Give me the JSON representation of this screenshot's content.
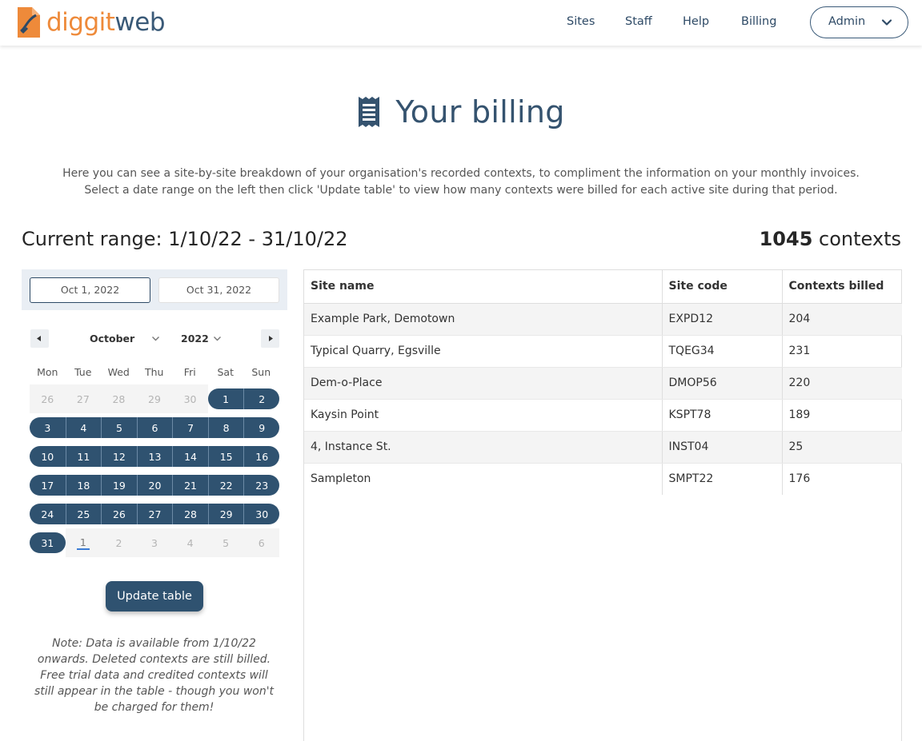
{
  "header": {
    "logo_part1": "diggit",
    "logo_part2": "web",
    "nav": [
      "Sites",
      "Staff",
      "Help",
      "Billing"
    ],
    "admin_label": "Admin"
  },
  "page": {
    "title": "Your billing",
    "intro_line1": "Here you can see a site-by-site breakdown of your organisation's recorded contexts, to compliment the information on your monthly invoices.",
    "intro_line2": "Select a date range on the left then click 'Update table' to view how many contexts were billed for each active site during that period.",
    "range_label": "Current range: 1/10/22 - 31/10/22",
    "count_value": "1045",
    "count_unit": "contexts"
  },
  "calendar": {
    "start_date": "Oct 1, 2022",
    "end_date": "Oct 31, 2022",
    "month": "October",
    "year": "2022",
    "weekdays": [
      "Mon",
      "Tue",
      "Wed",
      "Thu",
      "Fri",
      "Sat",
      "Sun"
    ],
    "weeks": [
      [
        "26",
        "27",
        "28",
        "29",
        "30",
        "1",
        "2"
      ],
      [
        "3",
        "4",
        "5",
        "6",
        "7",
        "8",
        "9"
      ],
      [
        "10",
        "11",
        "12",
        "13",
        "14",
        "15",
        "16"
      ],
      [
        "17",
        "18",
        "19",
        "20",
        "21",
        "22",
        "23"
      ],
      [
        "24",
        "25",
        "26",
        "27",
        "28",
        "29",
        "30"
      ],
      [
        "31",
        "1",
        "2",
        "3",
        "4",
        "5",
        "6"
      ]
    ],
    "update_button": "Update table",
    "note": "Note: Data is available from 1/10/22 onwards. Deleted contexts are still billed. Free trial data and credited contexts will still appear in the table - though you won't be charged for them!",
    "accent_color": "#2f5270"
  },
  "table": {
    "headers": [
      "Site name",
      "Site code",
      "Contexts billed"
    ],
    "rows": [
      [
        "Example Park, Demotown",
        "EXPD12",
        "204"
      ],
      [
        "Typical Quarry, Egsville",
        "TQEG34",
        "231"
      ],
      [
        "Dem-o-Place",
        "DMOP56",
        "220"
      ],
      [
        "Kaysin Point",
        "KSPT78",
        "189"
      ],
      [
        "4, Instance St.",
        "INST04",
        "25"
      ],
      [
        "Sampleton",
        "SMPT22",
        "176"
      ]
    ]
  }
}
